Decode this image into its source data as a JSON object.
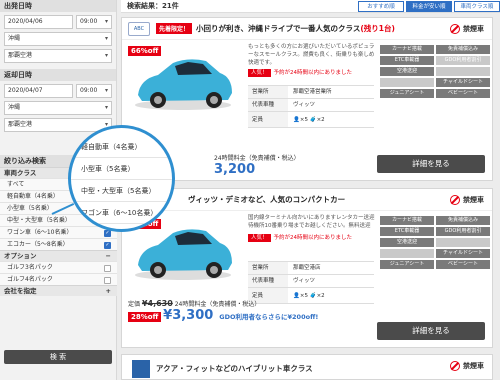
{
  "sidebar": {
    "departure_title": "出発日時",
    "departure_date": "2020/04/06",
    "departure_time": "09:00",
    "departure_pref": "沖縄",
    "departure_place": "那覇空港",
    "return_title": "返却日時",
    "return_date": "2020/04/07",
    "return_time": "09:00",
    "return_pref": "沖縄",
    "return_place": "那覇空港",
    "filter_title": "絞り込み検索",
    "car_class_title": "車両クラス",
    "items": [
      {
        "label": "すべて",
        "checked": false
      },
      {
        "label": "軽自動車（4名乗）",
        "checked": false
      },
      {
        "label": "小型車（5名乗）",
        "checked": true
      },
      {
        "label": "中型・大型車（5名乗）",
        "checked": true
      },
      {
        "label": "ワゴン車（6〜10名乗）",
        "checked": true
      },
      {
        "label": "エコカー（5〜8名乗）",
        "checked": true
      }
    ],
    "option_title": "オプション",
    "options": [
      "ゴルフ3名パック",
      "ゴルフ4名パック"
    ],
    "company_title": "会社を指定",
    "search_label": "検 索"
  },
  "header": {
    "result_count": "検索結果：21件",
    "tabs": [
      "おすすめ順",
      "料金が安い順",
      "車両クラス順"
    ],
    "active_tab": 1
  },
  "zoom_items": [
    "軽自動車（4名乗）",
    "小型車（5名乗）",
    "中型・大型車（5名乗）",
    "ワゴン車（6〜10名乗）"
  ],
  "cards": [
    {
      "logo": "ABC",
      "badge": "先着限定！",
      "title": "小回りが利き、沖縄ドライブで一番人気のクラス",
      "title_red": "(残り1台)",
      "nosmoke": "禁煙車",
      "off": "66%off",
      "desc": "もっとも多くの方にお選びいただいているポピュラーなスモールクラス。燃費も良く、街乗りも楽しめ快適です。",
      "popular": "人気！",
      "reserved": "予約が24時間以内にありました",
      "office_key": "営業所",
      "office_val": "那覇空港営業所",
      "model_key": "代表車種",
      "model_val": "ヴィッツ",
      "capacity_key": "定員",
      "capacity_val": "×5",
      "luggage_val": "×2",
      "features": [
        "カーナビ搭載",
        "免責補償込み",
        "ETC車載器",
        "GDO利用者割引",
        "空港送迎",
        "",
        "",
        "チャイルドシート",
        "ジュニアシート",
        "ベビーシート"
      ],
      "teika": "定価",
      "price_note": "24時間料金（免責補償・税込）",
      "price": "3,200",
      "detail": "詳細を見る"
    },
    {
      "title": "ヴィッツ・デミオなど、人気のコンパクトカー",
      "nosmoke": "禁煙車",
      "off": "28%off",
      "desc": "国内線ターミナル向かいにありますレンタカー送迎待機所10番乗り場までお越しください。無料送迎",
      "popular": "人気！",
      "reserved": "予約が24時間以内にありました",
      "office_key": "営業所",
      "office_val": "那覇空港店",
      "model_key": "代表車種",
      "model_val": "ヴィッツ",
      "capacity_key": "定員",
      "capacity_val": "×5",
      "luggage_val": "×2",
      "features": [
        "カーナビ搭載",
        "免責補償込み",
        "ETC車載器",
        "GDO利用者割引",
        "空港送迎",
        "",
        "",
        "チャイルドシート",
        "ジュニアシート",
        "ベビーシート"
      ],
      "teika": "定価",
      "old_price": "¥4,630",
      "price_note": "24時間料金（免責補償・税込）",
      "pct": "28%off",
      "price": "¥3,300",
      "gdo": "GDO利用者ならさらに¥200off!",
      "detail": "詳細を見る"
    },
    {
      "title": "アクア・フィットなどのハイブリット車クラス",
      "nosmoke": "禁煙車"
    }
  ],
  "colors": {
    "accent": "#2f6fc4",
    "red": "#e60012",
    "button": "#4b4b4b"
  }
}
